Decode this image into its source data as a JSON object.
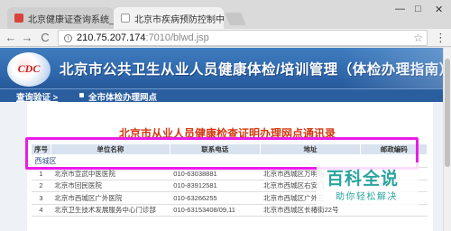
{
  "browser": {
    "tabs": [
      {
        "label": "北京健康证查询系统_百 ×",
        "active": false
      },
      {
        "label": "北京市疾病预防控制中心 ×",
        "active": true
      }
    ],
    "window_controls": {
      "minimize": "—",
      "maximize": "□",
      "close": "✕"
    },
    "nav": {
      "back": "←",
      "forward": "→",
      "reload": "C"
    },
    "address": {
      "host": "210.75.207.174",
      "path": ":7010/blwd.jsp"
    },
    "star": "☆",
    "menu": "⋮"
  },
  "page": {
    "logo_text": "CDC",
    "banner_title": "北京市公共卫生从业人员健康体检/培训管理（体检办理指南）",
    "nav": {
      "item1": "查询验证 >",
      "item2": "全市体检办理网点"
    },
    "heading": "北京市从业人员健康检查证明办理网点通讯录",
    "table": {
      "headers": [
        "序号",
        "单位名称",
        "联系电话",
        "地址",
        "邮政编码"
      ],
      "region": "西城区",
      "rows": [
        {
          "no": "1",
          "name": "北京市宣武中医医院",
          "phone": "010-63038881",
          "address": "北京市西城区万明路",
          "zip": ""
        },
        {
          "no": "2",
          "name": "北京市回民医院",
          "phone": "010-83912581",
          "address": "北京市西城区右安门",
          "zip": ""
        },
        {
          "no": "3",
          "name": "北京市西城区广外医院",
          "phone": "010-63266255",
          "address": "北京市西城区广外三",
          "zip": ""
        },
        {
          "no": "4",
          "name": "北京卫生技术发展服务中心门诊部",
          "phone": "010-63153408/09,11",
          "address": "北京市西城区长椿街22号",
          "zip": ""
        }
      ]
    }
  },
  "watermark": {
    "title": "百科全说",
    "subtitle": "助你轻松解决"
  },
  "colors": {
    "highlight": "#ea1ce8",
    "banner": "#2f69ad",
    "heading": "#d33a12",
    "watermark": "#2ba4a0"
  }
}
